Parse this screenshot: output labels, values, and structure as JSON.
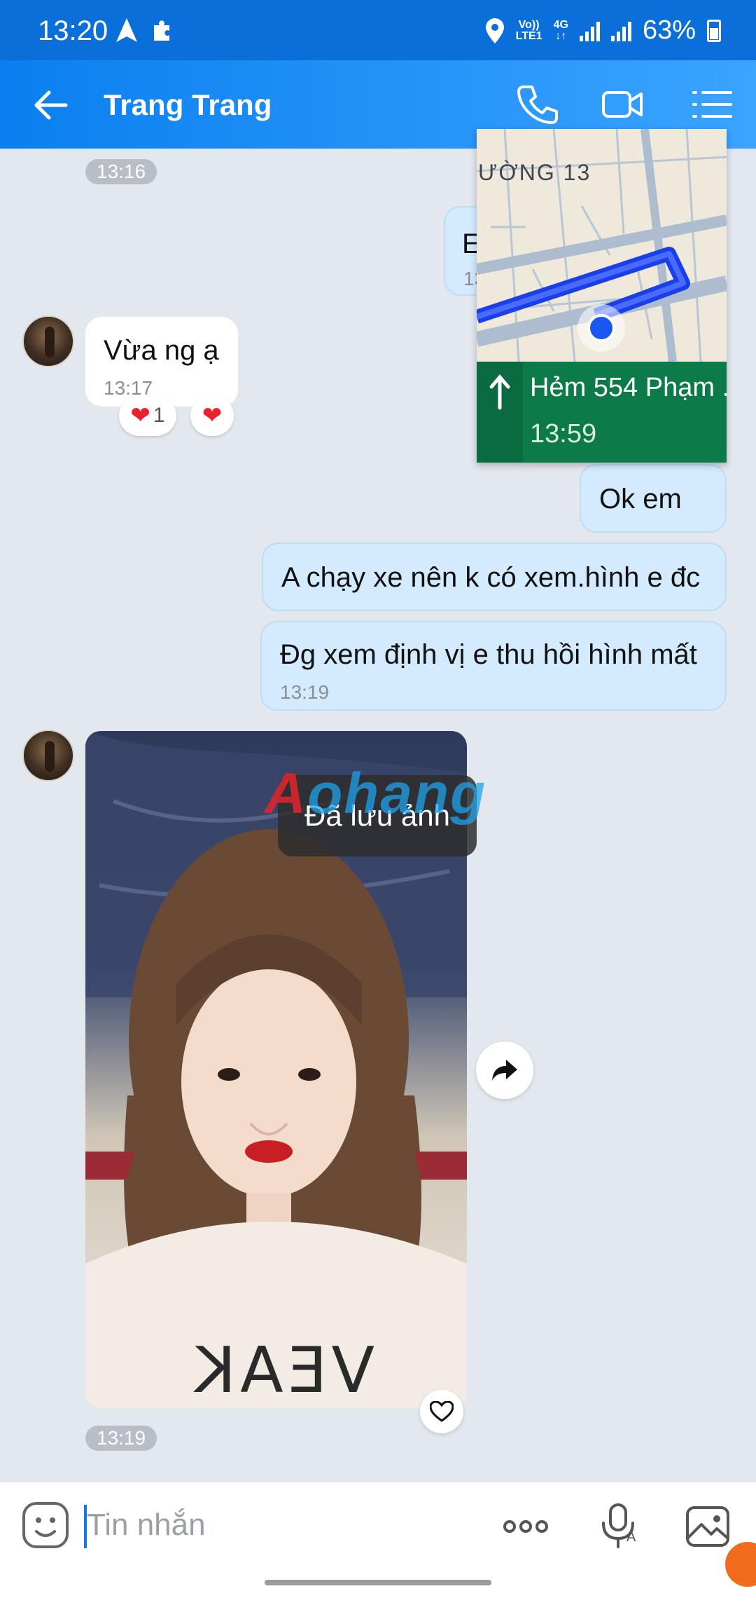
{
  "status_bar": {
    "time": "13:20",
    "network_label_top": "Vo))",
    "network_label_bottom": "LTE1",
    "data_label": "4G",
    "battery": "63%"
  },
  "header": {
    "contact_name": "Trang Trang",
    "icons": [
      "back-arrow-icon",
      "phone-icon",
      "video-call-icon",
      "menu-list-icon"
    ]
  },
  "messages": [
    {
      "type": "time-separator",
      "time": "13:16"
    },
    {
      "type": "outgoing-partial",
      "text_fragment": "E",
      "time_fragment": "13"
    },
    {
      "type": "incoming",
      "text": "Vừa ng ạ",
      "time": "13:17",
      "reactions": [
        {
          "icon": "heart",
          "count": "1"
        },
        {
          "icon": "heart",
          "count": ""
        }
      ]
    },
    {
      "type": "outgoing",
      "text": "Ok em"
    },
    {
      "type": "outgoing",
      "text": "A chạy xe nên k có xem.hình e đc"
    },
    {
      "type": "outgoing",
      "text": "Đg xem định vị e thu hồi hình mất",
      "time": "13:19"
    },
    {
      "type": "incoming-photo",
      "time": "13:19"
    }
  ],
  "map_overlay": {
    "street_label": "ƯỜNG 13",
    "nav_address": "Hẻm 554 Phạm ...",
    "nav_time": "13:59",
    "nav_arrow": "↑",
    "route_color": "#1a3ee8",
    "nav_color": "#0d7a4a"
  },
  "toast": {
    "text": "Đã lưu ảnh"
  },
  "watermark": {
    "first": "A",
    "rest": "ohang"
  },
  "photo_caption": {
    "sweater_text": "VEAK"
  },
  "input": {
    "placeholder": "Tin nhắn",
    "more_label": "ooo"
  },
  "colors": {
    "header_start": "#0b7ff0",
    "header_end": "#3aa4ff",
    "outgoing_bubble": "#d4ebff",
    "incoming_bubble": "#ffffff",
    "chat_background": "#e3e8ef"
  }
}
